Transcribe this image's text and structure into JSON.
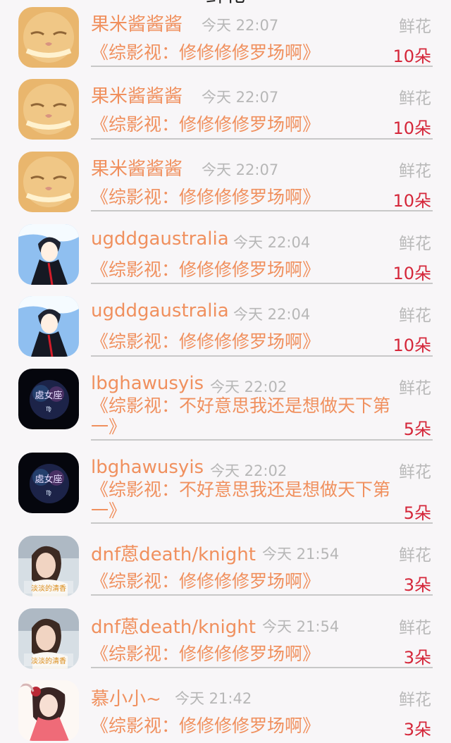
{
  "page": {
    "title": "鲜花"
  },
  "items": [
    {
      "avatar": "kitten-avatar",
      "name": "果米酱酱酱",
      "time": "今天 22:07",
      "gift_type": "鲜花",
      "work": "《综影视：修修修修罗场啊》",
      "count": "10朵"
    },
    {
      "avatar": "kitten-avatar",
      "name": "果米酱酱酱",
      "time": "今天 22:07",
      "gift_type": "鲜花",
      "work": "《综影视：修修修修罗场啊》",
      "count": "10朵"
    },
    {
      "avatar": "kitten-avatar",
      "name": "果米酱酱酱",
      "time": "今天 22:07",
      "gift_type": "鲜花",
      "work": "《综影视：修修修修罗场啊》",
      "count": "10朵"
    },
    {
      "avatar": "anime-boy-avatar",
      "name": "ugddgaustralia",
      "time": "今天 22:04",
      "gift_type": "鲜花",
      "work": "《综影视：修修修修罗场啊》",
      "count": "10朵"
    },
    {
      "avatar": "anime-boy-avatar",
      "name": "ugddgaustralia",
      "time": "今天 22:04",
      "gift_type": "鲜花",
      "work": "《综影视：修修修修罗场啊》",
      "count": "10朵"
    },
    {
      "avatar": "virgo-avatar",
      "avatar_text": "處女座",
      "name": "lbghawusyis",
      "time": "今天 22:02",
      "gift_type": "鲜花",
      "work": "《综影视：不好意思我还是想做天下第一》",
      "count": "5朵"
    },
    {
      "avatar": "virgo-avatar",
      "avatar_text": "處女座",
      "name": "lbghawusyis",
      "time": "今天 22:02",
      "gift_type": "鲜花",
      "work": "《综影视：不好意思我还是想做天下第一》",
      "count": "5朵"
    },
    {
      "avatar": "girl-photo-avatar",
      "avatar_text": "淡淡的清香",
      "name": "dnf蒽death/knight",
      "time": "今天 21:54",
      "gift_type": "鲜花",
      "work": "《综影视：修修修修罗场啊》",
      "count": "3朵"
    },
    {
      "avatar": "girl-photo-avatar",
      "avatar_text": "淡淡的清香",
      "name": "dnf蒽death/knight",
      "time": "今天 21:54",
      "gift_type": "鲜花",
      "work": "《综影视：修修修修罗场啊》",
      "count": "3朵"
    },
    {
      "avatar": "anime-girl-avatar",
      "name": "慕小小~",
      "time": "今天 21:42",
      "gift_type": "鲜花",
      "work": "《综影视：修修修修罗场啊》",
      "count": "3朵"
    }
  ]
}
